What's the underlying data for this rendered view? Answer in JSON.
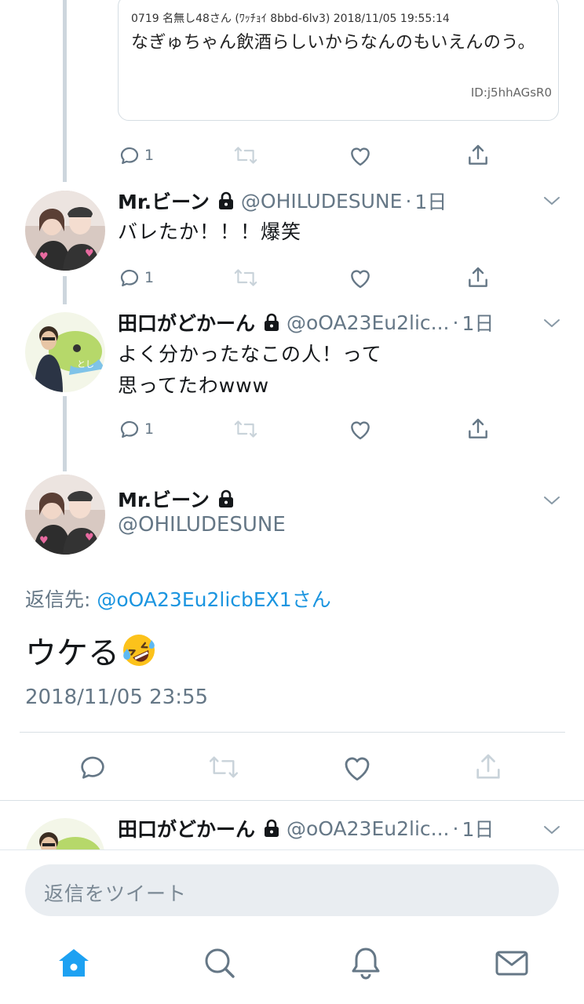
{
  "quoted": {
    "meta": "0719 名無し48さん (ﾜｯﾁｮｲ 8bbd-6lv3) 2018/11/05 19:55:14",
    "text": "なぎゅちゃん飲酒らしいからなんのもいえんのう。",
    "id": "ID:j5hhAGsR0",
    "reply_count": "1"
  },
  "tweets": [
    {
      "name": "Mr.ビーン",
      "handle": "@OHILUDESUNE",
      "dot": "·",
      "time": "1日",
      "text": "バレたか！！！爆笑",
      "reply_count": "1"
    },
    {
      "name": "田口がどかーん",
      "handle": "@oOA23Eu2lic...",
      "dot": "·",
      "time": "1日",
      "text_line1": "よく分かったなこの人！って",
      "text_line2": "思ってたわwww",
      "reply_count": "1"
    }
  ],
  "main_tweet": {
    "name": "Mr.ビーン",
    "handle": "@OHILUDESUNE",
    "replying_label": "返信先: ",
    "replying_to": "@oOA23Eu2licbEX1さん",
    "text": "ウケる",
    "date": "2018/11/05 23:55"
  },
  "next_tweet": {
    "name": "田口がどかーん",
    "handle": "@oOA23Eu2lic...",
    "dot": "·",
    "time": "1日"
  },
  "composer": {
    "placeholder": "返信をツイート"
  },
  "tabbar": [
    "home-icon",
    "search-icon",
    "notifications-icon",
    "messages-icon"
  ],
  "colors": {
    "accent": "#1da1f2",
    "link": "#1b95e0",
    "secondary_text": "#657786",
    "thread_line": "#cdd6dd"
  }
}
